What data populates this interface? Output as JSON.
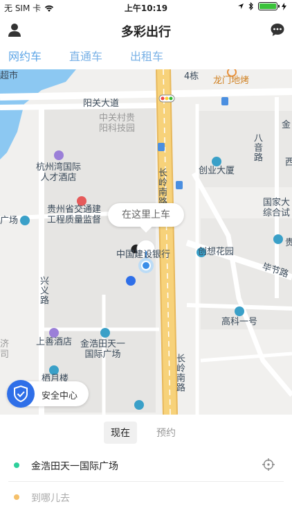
{
  "status_bar": {
    "carrier": "无 SIM 卡",
    "time": "上午10:19"
  },
  "nav": {
    "title": "多彩出行"
  },
  "tabs": [
    {
      "label": "网约车",
      "active": true
    },
    {
      "label": "直通车",
      "active": false
    },
    {
      "label": "出租车",
      "active": false
    }
  ],
  "map": {
    "labels": {
      "chaoshi": "超市",
      "sidong": "4栋",
      "longmen": "龙门地烤",
      "yangguan": "阳关大道",
      "zhongguancun": "中关村贵\n阳科技园",
      "bayin": "八音路",
      "jin": "金",
      "xi": "西",
      "hangzhouwan": "杭州湾国际\n人才酒店",
      "changling_n": "长岭南路",
      "chuangye": "创业大厦",
      "guizhou_jiaotong": "贵州省交通建\n工程质量监督",
      "guangchang": "广场",
      "guojia": "国家大\n综合试",
      "yinhang": "中国建设银行",
      "chuangxiang": "创想花园",
      "gui": "贵",
      "bijie": "毕节路",
      "xingyi": "兴义路",
      "gaoke": "高科一号",
      "shangshan": "上善酒店",
      "jinhao": "金浩田天一\n国际广场",
      "changling_s": "长岭南路",
      "ji": "济\n司",
      "bottom_partial": "栖月楼"
    },
    "pickup_bubble": "在这里上车",
    "safety_label": "安全中心"
  },
  "panel": {
    "modes": [
      {
        "label": "现在",
        "active": true
      },
      {
        "label": "预约",
        "active": false
      }
    ],
    "origin": "金浩田天一国际广场",
    "destination_placeholder": "到哪儿去"
  },
  "colors": {
    "accent": "#5ba4e6",
    "origin_dot": "#2ecf9b",
    "destination_dot": "#f5c06a",
    "safety": "#2f6fe8",
    "water": "#8cc8f2",
    "road_major": "#f7d27a"
  }
}
